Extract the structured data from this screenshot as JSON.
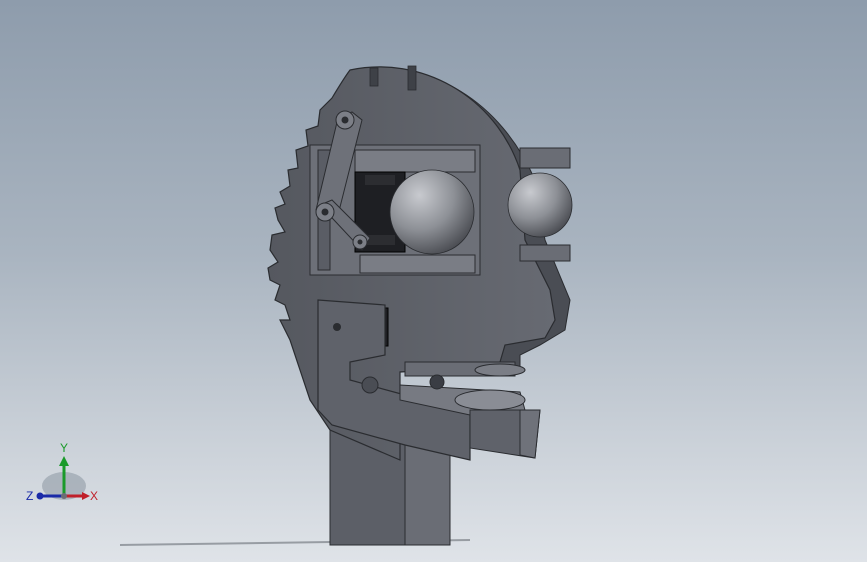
{
  "view": {
    "background_top": "#8e9cac",
    "background_bottom": "#dfe3e8",
    "part_color": "#5b5e66",
    "part_edge_color": "#2a2c30",
    "sphere_color": "#8d9096"
  },
  "model": {
    "description_icon": "robot-head-assembly"
  },
  "triad": {
    "x_label": "X",
    "y_label": "Y",
    "z_label": "Z",
    "x_color": "#c0202a",
    "y_color": "#1a9a2a",
    "z_color": "#1a2aa8"
  }
}
